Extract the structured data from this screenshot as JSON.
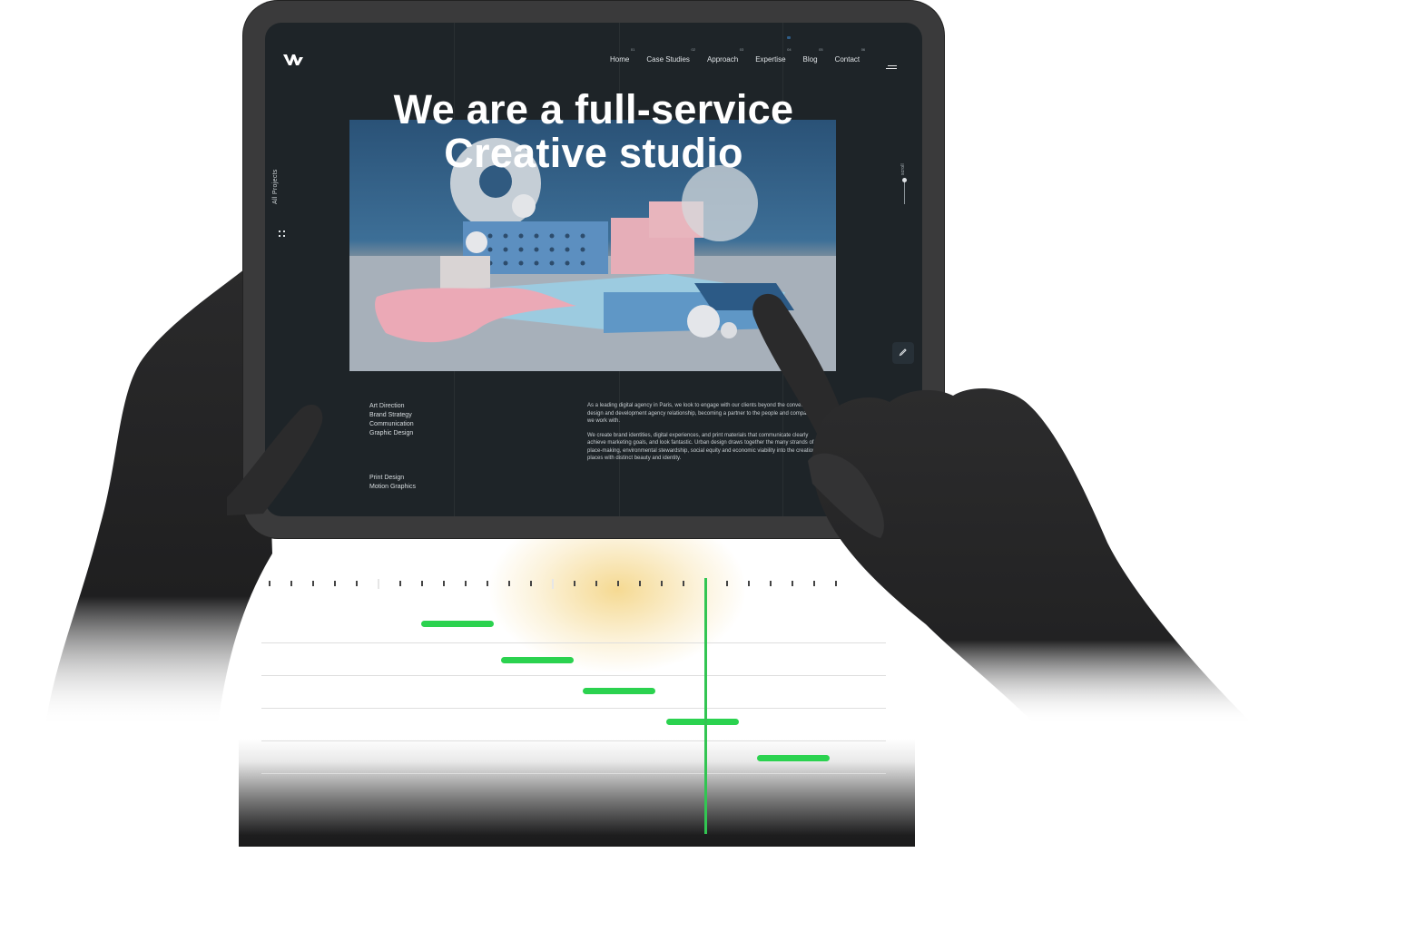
{
  "nav": {
    "items": [
      {
        "num": "01",
        "label": "Home"
      },
      {
        "num": "02",
        "label": "Case Studies"
      },
      {
        "num": "03",
        "label": "Approach"
      },
      {
        "num": "04",
        "label": "Expertise"
      },
      {
        "num": "05",
        "label": "Blog"
      },
      {
        "num": "06",
        "label": "Contact"
      }
    ]
  },
  "hero": {
    "title_line1": "We are a full-service",
    "title_line2": "Creative studio"
  },
  "sidebar": {
    "all_projects_label": "All Projects",
    "scroll_label": "scroll"
  },
  "services": {
    "group1": [
      "Art Direction",
      "Brand Strategy",
      "Communication",
      "Graphic Design"
    ],
    "group2": [
      "Print Design",
      "Motion Graphics"
    ]
  },
  "about": {
    "paragraph1": "As a leading digital agency in Paris, we look to engage with our clients beyond the conventional design and development agency relationship, becoming a partner to the people and companies we work with.",
    "paragraph2": "We create brand identities, digital experiences, and print materials that communicate clearly achieve marketing goals, and look fantastic. Urban design draws together the many strands of place-making, environmental stewardship, social equity and economic viability into the creation of places with distinct beauty and identity."
  },
  "timeline": {
    "bar_color": "#2bd24f",
    "playhead_color": "#32c552"
  },
  "theme": {
    "screen_bg": "#1e2428",
    "accent_blue": "#2f5d86"
  },
  "icons": [
    "logo-w-icon",
    "menu-icon",
    "grid-icon",
    "pencil-icon"
  ]
}
